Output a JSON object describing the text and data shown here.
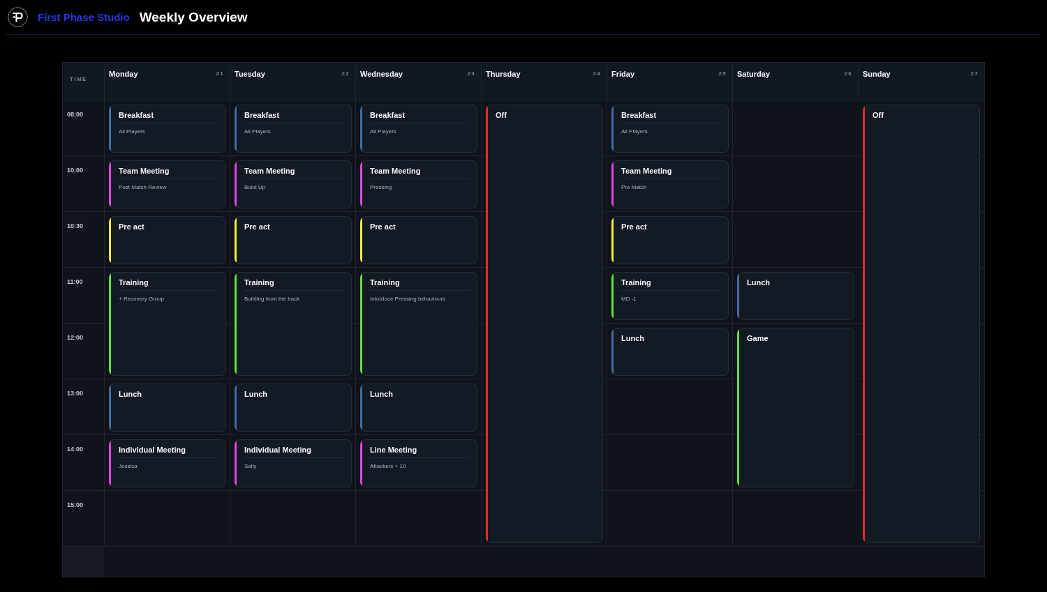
{
  "header": {
    "brand": "First Phase Studio",
    "title": "Weekly Overview"
  },
  "calendar": {
    "time_header": "TIME",
    "times": [
      "08:00",
      "10:00",
      "10:30",
      "11:00",
      "12:00",
      "13:00",
      "14:00",
      "15:00"
    ],
    "days": [
      {
        "name": "Monday",
        "date": "21",
        "slots": [
          {
            "kind": "event",
            "title": "Breakfast",
            "subtitle": "All Players",
            "color": "#3d6ea8"
          },
          {
            "kind": "event",
            "title": "Team Meeting",
            "subtitle": "Post Match Review",
            "color": "#e146e8"
          },
          {
            "kind": "event",
            "title": "Pre act",
            "color": "#f0ef3c"
          },
          {
            "kind": "event",
            "title": "Training",
            "subtitle": "+ Recovery Group",
            "color": "#62e13c"
          },
          {
            "kind": "continued"
          },
          {
            "kind": "event",
            "title": "Lunch",
            "color": "#3d6ea8"
          },
          {
            "kind": "event",
            "title": "Individual Meeting",
            "subtitle": "Jessica",
            "color": "#e146e8"
          },
          {
            "kind": "empty"
          }
        ]
      },
      {
        "name": "Tuesday",
        "date": "22",
        "slots": [
          {
            "kind": "event",
            "title": "Breakfast",
            "subtitle": "All Players",
            "color": "#3d6ea8"
          },
          {
            "kind": "event",
            "title": "Team Meeting",
            "subtitle": "Build Up",
            "color": "#e146e8"
          },
          {
            "kind": "event",
            "title": "Pre act",
            "color": "#f0ef3c"
          },
          {
            "kind": "event",
            "title": "Training",
            "subtitle": "Building from the back",
            "color": "#62e13c"
          },
          {
            "kind": "continued"
          },
          {
            "kind": "event",
            "title": "Lunch",
            "color": "#3d6ea8"
          },
          {
            "kind": "event",
            "title": "Individual Meeting",
            "subtitle": "Sally",
            "color": "#e146e8"
          },
          {
            "kind": "empty"
          }
        ]
      },
      {
        "name": "Wednesday",
        "date": "23",
        "slots": [
          {
            "kind": "event",
            "title": "Breakfast",
            "subtitle": "All Players",
            "color": "#3d6ea8"
          },
          {
            "kind": "event",
            "title": "Team Meeting",
            "subtitle": "Pressing",
            "color": "#e146e8"
          },
          {
            "kind": "event",
            "title": "Pre act",
            "color": "#f0ef3c"
          },
          {
            "kind": "event",
            "title": "Training",
            "subtitle": "Introduce Pressing behaviours",
            "color": "#62e13c"
          },
          {
            "kind": "continued"
          },
          {
            "kind": "event",
            "title": "Lunch",
            "color": "#3d6ea8"
          },
          {
            "kind": "event",
            "title": "Line Meeting",
            "subtitle": "Attackers + 10",
            "color": "#e146e8"
          },
          {
            "kind": "empty"
          }
        ]
      },
      {
        "name": "Thursday",
        "date": "24",
        "slots": [
          {
            "kind": "event",
            "title": "Off",
            "color": "#dc2f2f"
          },
          {
            "kind": "continued"
          },
          {
            "kind": "continued"
          },
          {
            "kind": "continued"
          },
          {
            "kind": "continued"
          },
          {
            "kind": "continued"
          },
          {
            "kind": "continued"
          },
          {
            "kind": "continued"
          }
        ]
      },
      {
        "name": "Friday",
        "date": "25",
        "slots": [
          {
            "kind": "event",
            "title": "Breakfast",
            "subtitle": "All Players",
            "color": "#3d6ea8"
          },
          {
            "kind": "event",
            "title": "Team Meeting",
            "subtitle": "Pre Match",
            "color": "#e146e8"
          },
          {
            "kind": "event",
            "title": "Pre act",
            "color": "#f0ef3c"
          },
          {
            "kind": "event",
            "title": "Training",
            "subtitle": "MD -1",
            "color": "#62e13c"
          },
          {
            "kind": "event",
            "title": "Lunch",
            "color": "#3d6ea8"
          },
          {
            "kind": "empty"
          },
          {
            "kind": "empty"
          },
          {
            "kind": "empty"
          }
        ]
      },
      {
        "name": "Saturday",
        "date": "26",
        "slots": [
          {
            "kind": "empty"
          },
          {
            "kind": "empty"
          },
          {
            "kind": "empty"
          },
          {
            "kind": "event",
            "title": "Lunch",
            "color": "#3d6ea8"
          },
          {
            "kind": "event",
            "title": "Game",
            "color": "#62e13c"
          },
          {
            "kind": "continued"
          },
          {
            "kind": "continued"
          },
          {
            "kind": "empty"
          }
        ]
      },
      {
        "name": "Sunday",
        "date": "27",
        "slots": [
          {
            "kind": "event",
            "title": "Off",
            "color": "#dc2f2f"
          },
          {
            "kind": "continued"
          },
          {
            "kind": "continued"
          },
          {
            "kind": "continued"
          },
          {
            "kind": "continued"
          },
          {
            "kind": "continued"
          },
          {
            "kind": "continued"
          },
          {
            "kind": "continued"
          }
        ]
      }
    ]
  }
}
